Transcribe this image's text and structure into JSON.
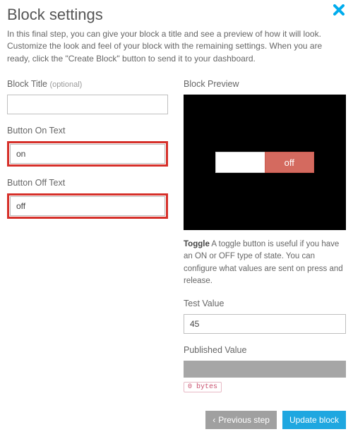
{
  "header": {
    "title": "Block settings",
    "description": "In this final step, you can give your block a title and see a preview of how it will look. Customize the look and feel of your block with the remaining settings. When you are ready, click the \"Create Block\" button to send it to your dashboard."
  },
  "left": {
    "title_label": "Block Title",
    "title_optional": "(optional)",
    "title_value": "",
    "on_label": "Button On Text",
    "on_value": "on",
    "off_label": "Button Off Text",
    "off_value": "off"
  },
  "right": {
    "preview_label": "Block Preview",
    "toggle_text": "off",
    "caption_bold": "Toggle",
    "caption_text": " A toggle button is useful if you have an ON or OFF type of state. You can configure what values are sent on press and release.",
    "test_label": "Test Value",
    "test_value": "45",
    "pub_label": "Published Value",
    "bytes": "0 bytes"
  },
  "footer": {
    "prev": "Previous step",
    "update": "Update block"
  }
}
